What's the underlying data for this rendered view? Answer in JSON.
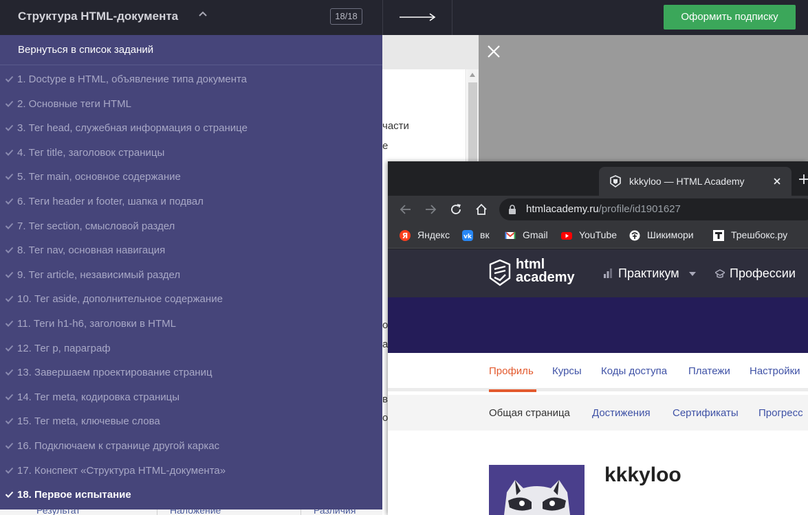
{
  "topbar": {
    "course_title": "Структура HTML-документа",
    "progress": "18/18",
    "subscribe_label": "Оформить подписку",
    "subscribe_color": "#3ba75a"
  },
  "sidebar": {
    "back_label": "Вернуться в список заданий",
    "tasks": [
      {
        "label": "1. Doctype в HTML, объявление типа документа",
        "done": true
      },
      {
        "label": "2. Основные теги HTML",
        "done": true
      },
      {
        "label": "3. Тег head, служебная информация о странице",
        "done": true
      },
      {
        "label": "4. Тег title, заголовок страницы",
        "done": true
      },
      {
        "label": "5. Тег main, основное содержание",
        "done": true
      },
      {
        "label": "6. Теги header и footer, шапка и подвал",
        "done": true
      },
      {
        "label": "7. Тег section, смысловой раздел",
        "done": true
      },
      {
        "label": "8. Тег nav, основная навигация",
        "done": true
      },
      {
        "label": "9. Тег article, независимый раздел",
        "done": true
      },
      {
        "label": "10. Тег aside, дополнительное содержание",
        "done": true
      },
      {
        "label": "11. Теги h1-h6, заголовки в HTML",
        "done": true
      },
      {
        "label": "12. Тег p, параграф",
        "done": true
      },
      {
        "label": "13. Завершаем проектирование страниц",
        "done": true
      },
      {
        "label": "14. Тег meta, кодировка страницы",
        "done": true
      },
      {
        "label": "15. Тег meta, ключевые слова",
        "done": true
      },
      {
        "label": "16. Подключаем к странице другой каркас",
        "done": true
      },
      {
        "label": "17. Конспект «Структура HTML-документа»",
        "done": true
      },
      {
        "label": "18. Первое испытание",
        "done": true,
        "active": true
      }
    ]
  },
  "background_page": {
    "text_fragments": [
      "части",
      "е",
      "о",
      "ла",
      "о",
      "аз",
      "в",
      "о"
    ],
    "bottom_tabs": [
      "Результат",
      "Наложение",
      "Различия"
    ]
  },
  "browser": {
    "tab_title": "kkkyloo — HTML Academy",
    "url_host": "htmlacademy.ru",
    "url_path": "/profile/id1901627",
    "bookmarks": [
      {
        "label": "Яндекс",
        "icon": "yandex-icon"
      },
      {
        "label": "вк",
        "icon": "vk-icon"
      },
      {
        "label": "Gmail",
        "icon": "gmail-icon"
      },
      {
        "label": "YouTube",
        "icon": "youtube-icon"
      },
      {
        "label": "Шикимори",
        "icon": "shikimori-icon"
      },
      {
        "label": "Трешбокс.ру",
        "icon": "trashbox-icon"
      }
    ]
  },
  "site": {
    "logo_line1": "html",
    "logo_line2": "academy",
    "nav": [
      "Практикум",
      "Профессии"
    ],
    "profile_tabs": [
      "Профиль",
      "Курсы",
      "Коды доступа",
      "Платежи",
      "Настройки"
    ],
    "active_profile_tab": "Профиль",
    "sub_tabs": [
      "Общая страница",
      "Достижения",
      "Сертификаты",
      "Прогресс"
    ],
    "username": "kkkyloo"
  }
}
